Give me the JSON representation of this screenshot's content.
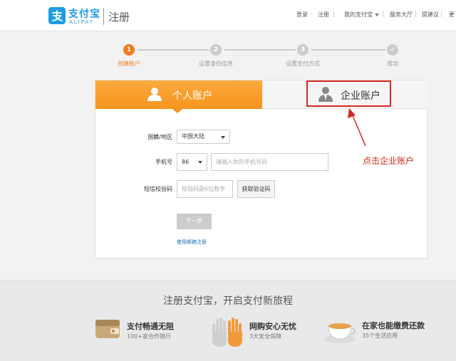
{
  "header": {
    "logo_cn": "支付宝",
    "logo_en": "ALIPAY",
    "page_title": "注册",
    "nav": {
      "login": "登录",
      "register": "注册",
      "my_alipay": "我的支付宝",
      "service_hall": "服务大厅",
      "feedback": "提建议",
      "more": "更"
    }
  },
  "steps": [
    {
      "number": "1",
      "label": "创建账户",
      "active": true
    },
    {
      "number": "2",
      "label": "设置身份信息",
      "active": false
    },
    {
      "number": "3",
      "label": "设置支付方式",
      "active": false
    },
    {
      "number": "✓",
      "label": "成功",
      "active": false
    }
  ],
  "tabs": {
    "personal": "个人账户",
    "enterprise": "企业账户"
  },
  "form": {
    "region_label": "国籍/地区",
    "region_value": "中国大陆",
    "phone_label": "手机号",
    "phone_code": "86",
    "phone_placeholder": "请输入你的手机号码",
    "sms_label": "短信校验码",
    "sms_placeholder": "校验码是6位数字",
    "get_code_button": "获取验证码",
    "next_button": "下一步",
    "email_register_link": "使用邮箱注册"
  },
  "annotation": {
    "text": "点击企业账户",
    "color": "#d8281f"
  },
  "footer": {
    "title": "注册支付宝，开启支付新旅程",
    "features": [
      {
        "icon": "wallet-icon",
        "title": "支付畅通无阻",
        "sub": "100+家合作银行"
      },
      {
        "icon": "hands-icon",
        "title": "网购安心无忧",
        "sub": "3大安全保障"
      },
      {
        "icon": "teacup-icon",
        "title": "在家也能缴费还款",
        "sub": "35个生活应用"
      }
    ]
  },
  "colors": {
    "brand_blue": "#1f9be4",
    "accent_orange": "#f7931e"
  }
}
